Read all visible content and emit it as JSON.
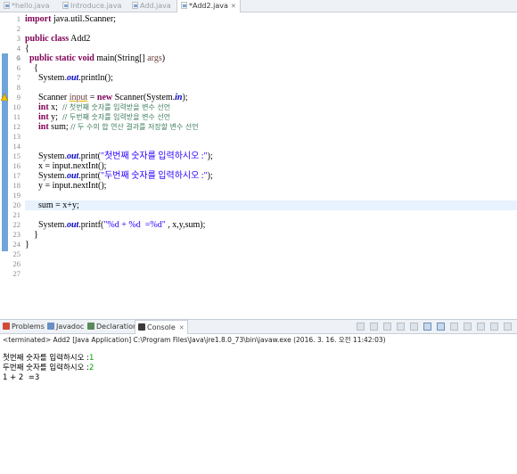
{
  "tabs": [
    {
      "label": "*hello.java",
      "active": false
    },
    {
      "label": "Introduce.java",
      "active": false
    },
    {
      "label": "Add.java",
      "active": false
    },
    {
      "label": "*Add2.java",
      "active": true
    }
  ],
  "editor": {
    "line_numbers": [
      "1",
      "2",
      "3",
      "4",
      "5",
      "6",
      "7",
      "8",
      "9",
      "10",
      "11",
      "12",
      "13",
      "14",
      "15",
      "16",
      "17",
      "18",
      "19",
      "20",
      "21",
      "22",
      "23",
      "24",
      "25",
      "26",
      "27"
    ],
    "code": {
      "l1_kw": "import",
      "l1_rest": " java.util.Scanner;",
      "l3_kw": "public class",
      "l3_rest": " Add2",
      "l4": "{",
      "l5_indent": "  ",
      "l5_kw": "public static void",
      "l5_rest": " main(String[] ",
      "l5_var": "args",
      "l5_end": ")",
      "l6": "    {",
      "l7_a": "      System.",
      "l7_st": "out",
      "l7_b": ".println();",
      "l9_a": "      Scanner ",
      "l9_var": "input",
      "l9_b": " = ",
      "l9_kw": "new",
      "l9_c": " Scanner(System.",
      "l9_st": "in",
      "l9_d": ");",
      "l10_kw": "int",
      "l10_rest": " x;  ",
      "l10_cm": "// 첫번째 숫자를 입력받을 변수 선언",
      "l11_kw": "int",
      "l11_rest": " y;  ",
      "l11_cm": "// 두번째 숫자를 입력받을 변수 선언",
      "l12_kw": "int",
      "l12_rest": " sum; ",
      "l12_cm": "// 두 수의 합 연산 결과를 저장할 변수 선언",
      "l15_a": "      System.",
      "l15_st": "out",
      "l15_b": ".print(",
      "l15_str": "\"첫번째 숫자를 입력하시오 :\"",
      "l15_c": ");",
      "l16": "      x = input.nextInt();",
      "l17_a": "      System.",
      "l17_st": "out",
      "l17_b": ".print(",
      "l17_str": "\"두번째 숫자를 입력하시오 :\"",
      "l17_c": ");",
      "l18": "      y = input.nextInt();",
      "l20": "      sum = x+y;",
      "l22_a": "      System.",
      "l22_st": "out",
      "l22_b": ".printf(",
      "l22_str": "\"%d + %d  =%d\"",
      "l22_c": " , x,y,sum);",
      "l23": "    }",
      "l24": "}"
    }
  },
  "views": [
    {
      "label": "Problems",
      "active": false,
      "icon_color": "#d04a3a"
    },
    {
      "label": "Javadoc",
      "active": false,
      "icon_color": "#6a8fc4"
    },
    {
      "label": "Declaration",
      "active": false,
      "icon_color": "#5a8a5a"
    },
    {
      "label": "Console",
      "active": true,
      "icon_color": "#3a3a3a"
    }
  ],
  "console": {
    "status": "<terminated> Add2 [Java Application] C:\\Program Files\\Java\\jre1.8.0_73\\bin\\javaw.exe (2016. 3. 16. 오전 11:42:03)",
    "lines": [
      {
        "text": "첫번째 숫자를 입력하시오 :",
        "input": "1"
      },
      {
        "text": "두번째 숫자를 입력하시오 :",
        "input": "2"
      },
      {
        "text": "1 + 2  =3",
        "input": ""
      }
    ]
  },
  "colors": {
    "keyword": "#7f0055",
    "static_field": "#0000c0",
    "string": "#2a00ff",
    "comment": "#3f7f5f",
    "console_input": "#00a000"
  },
  "icons": [
    "java-file-icon",
    "close-icon",
    "fold-icon",
    "warning-icon",
    "problems-icon",
    "javadoc-icon",
    "declaration-icon",
    "console-icon"
  ]
}
